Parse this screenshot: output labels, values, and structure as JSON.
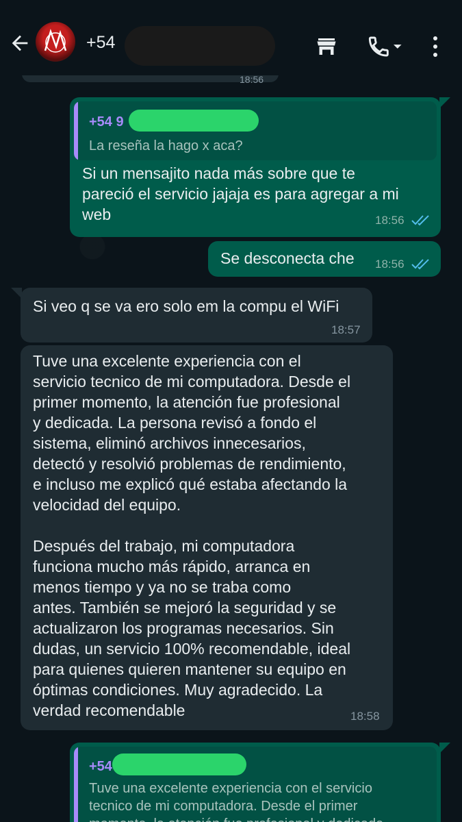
{
  "header": {
    "contact": "+54",
    "icons": {
      "back": "arrow-left-icon",
      "store": "storefront-icon",
      "call": "phone-icon",
      "menu": "more-vertical-icon"
    }
  },
  "previous_time": "18:56",
  "messages": [
    {
      "direction": "out",
      "quote_author": "+54 9",
      "quote_text": "La reseña la hago x aca?",
      "text": "Si un mensajito nada más sobre que te\npareció el servicio jajaja es para agregar a mi\nweb",
      "time": "18:56",
      "status": "read"
    },
    {
      "direction": "out",
      "text": "Se desconecta che",
      "time": "18:56",
      "status": "read"
    },
    {
      "direction": "in",
      "text": "Si veo q se va ero solo em la compu el WiFi",
      "time": "18:57"
    },
    {
      "direction": "in",
      "text": "Tuve una excelente experiencia con el\nservicio tecnico de mi computadora. Desde el\nprimer momento, la atención fue profesional\ny dedicada. La persona revisó a fondo el\nsistema, eliminó archivos innecesarios,\ndetectó y resolvió problemas de rendimiento,\ne incluso me explicó qué estaba afectando la\nvelocidad del equipo.\n\nDespués del trabajo, mi computadora\nfunciona mucho más rápido, arranca en\nmenos tiempo y ya no se traba como\nantes. También se mejoró la seguridad y se\nactualizaron los programas necesarios. Sin\ndudas, un servicio 100% recomendable, ideal\npara quienes quieren mantener su equipo en\nóptimas condiciones. Muy agradecido. La\nverdad recomendable",
      "time": "18:58"
    },
    {
      "direction": "out",
      "quote_author": "+54",
      "quote_text": "Tuve una excelente experiencia con el servicio\ntecnico de mi computadora. Desde el primer\nmomento, la atención fue profesional y dedicada"
    }
  ],
  "colors": {
    "background": "#0b141a",
    "outgoing_bubble": "#005c4b",
    "incoming_bubble": "#1f2c33",
    "quote_accent": "#a78bfa",
    "read_ticks": "#53bdeb"
  }
}
